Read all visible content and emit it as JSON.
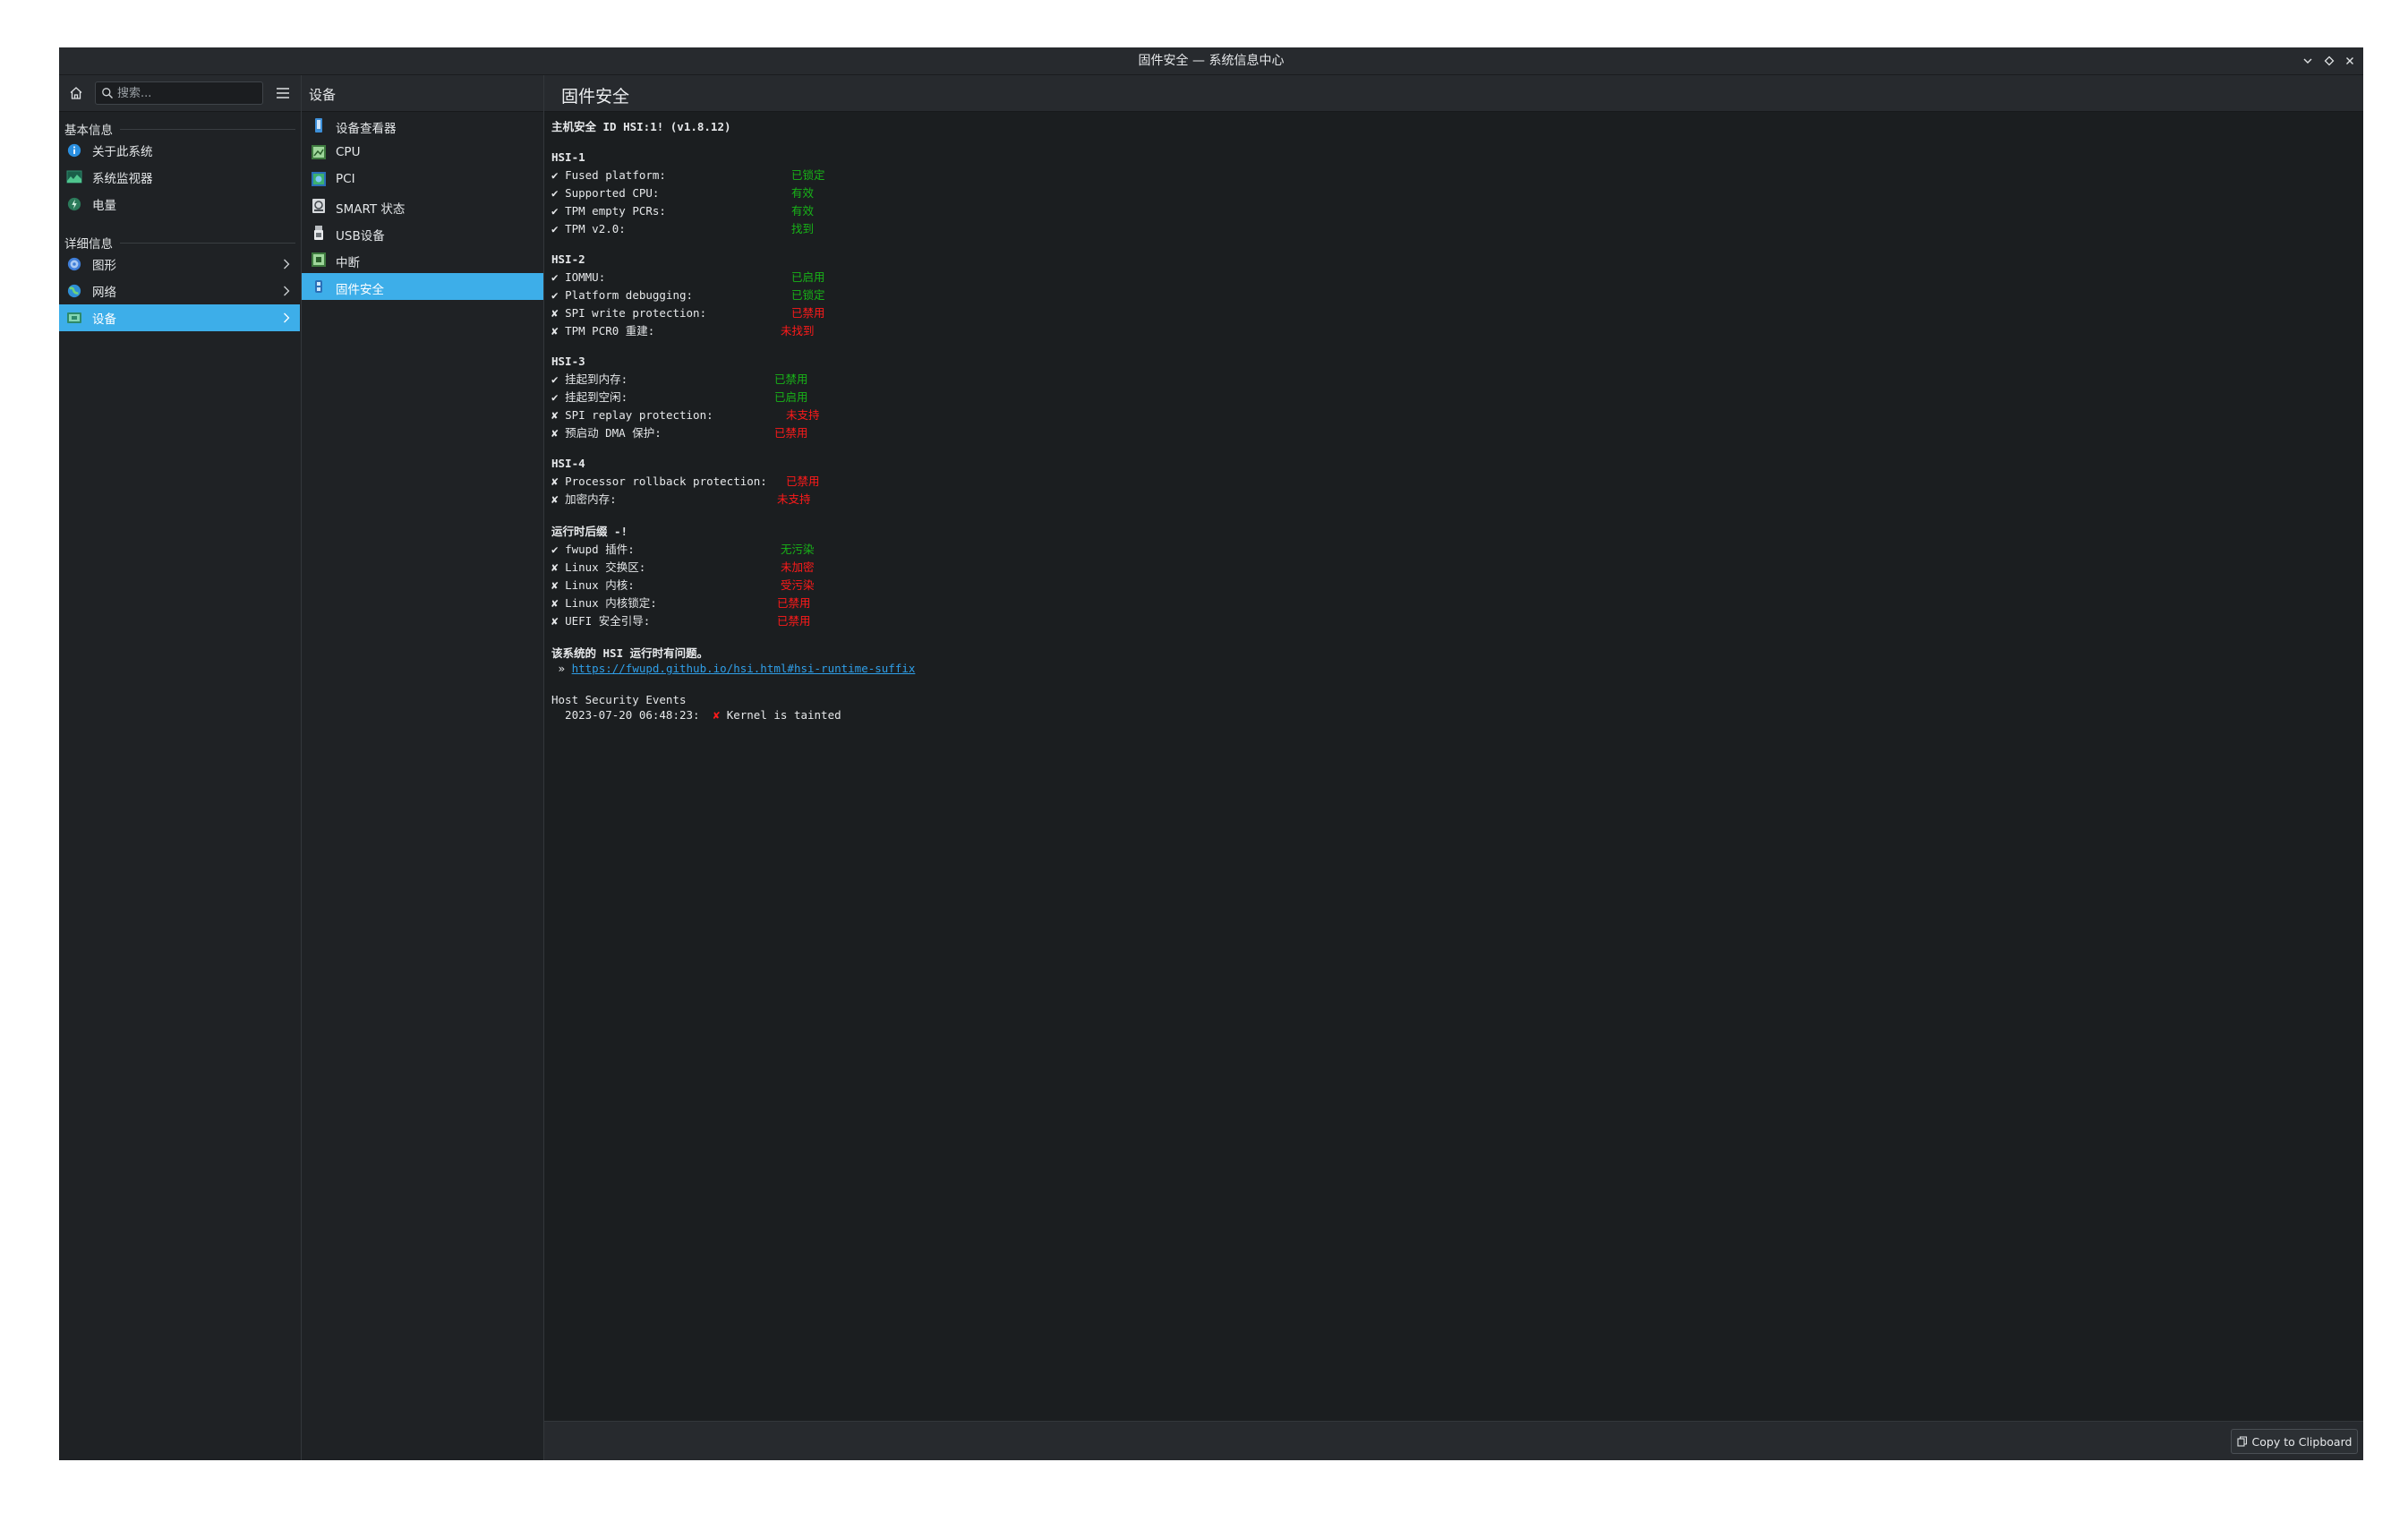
{
  "window": {
    "title": "固件安全 — 系统信息中心"
  },
  "sidebar": {
    "search_placeholder": "搜索...",
    "section_basic": "基本信息",
    "basic_items": [
      {
        "label": "关于此系统",
        "icon": "info-icon"
      },
      {
        "label": "系统监视器",
        "icon": "system-monitor-icon"
      },
      {
        "label": "电量",
        "icon": "power-icon"
      }
    ],
    "section_detail": "详细信息",
    "detail_items": [
      {
        "label": "图形",
        "icon": "graphics-icon"
      },
      {
        "label": "网络",
        "icon": "network-icon"
      },
      {
        "label": "设备",
        "icon": "devices-icon"
      }
    ]
  },
  "middle": {
    "title": "设备",
    "items": [
      {
        "label": "设备查看器",
        "icon": "device-viewer-icon"
      },
      {
        "label": "CPU",
        "icon": "cpu-icon"
      },
      {
        "label": "PCI",
        "icon": "pci-icon"
      },
      {
        "label": "SMART 状态",
        "icon": "smart-status-icon"
      },
      {
        "label": "USB设备",
        "icon": "usb-icon"
      },
      {
        "label": "中断",
        "icon": "interrupts-icon"
      },
      {
        "label": "固件安全",
        "icon": "firmware-security-icon"
      }
    ]
  },
  "content": {
    "title": "固件安全",
    "host_id": "主机安全 ID HSI:1! (v1.8.12)",
    "groups": [
      {
        "title": "HSI-1",
        "rows": [
          {
            "mark": "✔",
            "key": "Fused platform:",
            "value": "已锁定",
            "ok": true
          },
          {
            "mark": "✔",
            "key": "Supported CPU:",
            "value": "有效",
            "ok": true
          },
          {
            "mark": "✔",
            "key": "TPM empty PCRs:",
            "value": "有效",
            "ok": true
          },
          {
            "mark": "✔",
            "key": "TPM v2.0:",
            "value": "找到",
            "ok": true
          }
        ]
      },
      {
        "title": "HSI-2",
        "rows": [
          {
            "mark": "✔",
            "key": "IOMMU:",
            "value": "已启用",
            "ok": true
          },
          {
            "mark": "✔",
            "key": "Platform debugging:",
            "value": "已锁定",
            "ok": true
          },
          {
            "mark": "✘",
            "key": "SPI write protection:",
            "value": "已禁用",
            "ok": false
          },
          {
            "mark": "✘",
            "key": "TPM PCR0 重建:",
            "value": "未找到",
            "ok": false
          }
        ]
      },
      {
        "title": "HSI-3",
        "rows": [
          {
            "mark": "✔",
            "key": "挂起到内存:",
            "value": "已禁用",
            "ok": true
          },
          {
            "mark": "✔",
            "key": "挂起到空闲:",
            "value": "已启用",
            "ok": true
          },
          {
            "mark": "✘",
            "key": "SPI replay protection:",
            "value": "未支持",
            "ok": false
          },
          {
            "mark": "✘",
            "key": "预启动 DMA 保护:",
            "value": "已禁用",
            "ok": false
          }
        ]
      },
      {
        "title": "HSI-4",
        "rows": [
          {
            "mark": "✘",
            "key": "Processor rollback protection:",
            "value": "已禁用",
            "ok": false
          },
          {
            "mark": "✘",
            "key": "加密内存:",
            "value": "未支持",
            "ok": false
          }
        ]
      },
      {
        "title": "运行时后缀 -!",
        "rows": [
          {
            "mark": "✔",
            "key": "fwupd 插件:",
            "value": "无污染",
            "ok": true
          },
          {
            "mark": "✘",
            "key": "Linux 交换区:",
            "value": "未加密",
            "ok": false
          },
          {
            "mark": "✘",
            "key": "Linux 内核:",
            "value": "受污染",
            "ok": false
          },
          {
            "mark": "✘",
            "key": "Linux 内核锁定:",
            "value": "已禁用",
            "ok": false
          },
          {
            "mark": "✘",
            "key": "UEFI 安全引导:",
            "value": "已禁用",
            "ok": false
          }
        ]
      }
    ],
    "runtime_issue": "该系统的 HSI 运行时有问题。",
    "link_prefix": " »",
    "link": "https://fwupd.github.io/hsi.html#hsi-runtime-suffix",
    "events_title": "Host Security Events",
    "event_time": "  2023-07-20 06:48:23:",
    "event_mark": "✘",
    "event_text": "Kernel is tainted",
    "copy_button": "Copy to Clipboard"
  },
  "colors": {
    "accent": "#3daee9",
    "ok": "#18b318",
    "bad": "#ff1a1a",
    "link": "#2f9fe8"
  }
}
